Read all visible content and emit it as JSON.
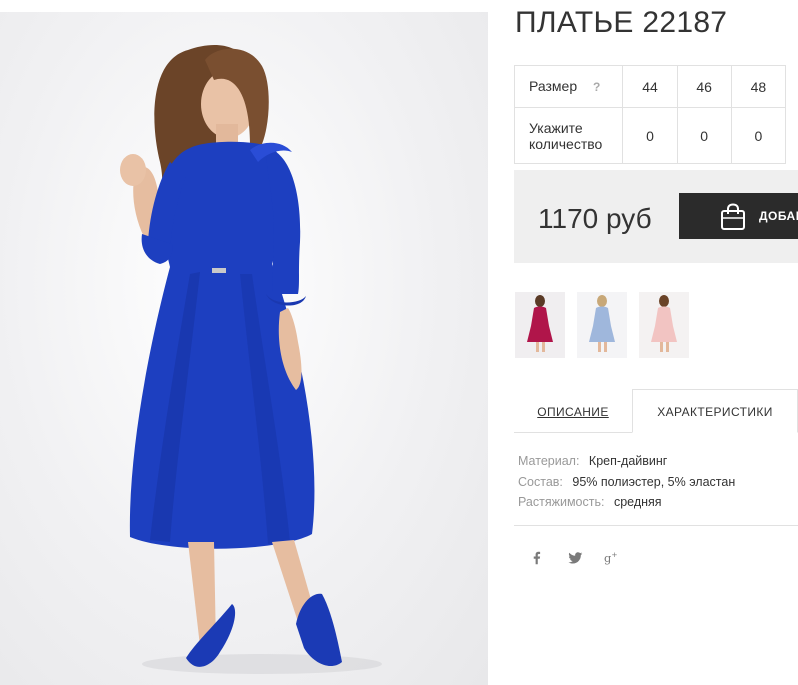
{
  "product": {
    "title": "ПЛАТЬЕ 22187",
    "image_alt": "Model wearing royal blue midi dress with ruffle sleeves and blue pumps"
  },
  "size_table": {
    "size_label": "Размер",
    "help_label": "?",
    "sizes": [
      "44",
      "46",
      "48"
    ],
    "quantity_label_line1": "Укажите",
    "quantity_label_line2": "количество",
    "quantities": [
      "0",
      "0",
      "0"
    ]
  },
  "purchase": {
    "price": "1170 руб",
    "cart_button_label": "ДОБАВИТЬ В КОРЗИНУ"
  },
  "thumbnails": [
    {
      "name": "thumb-magenta-dress",
      "color": "#b0154a"
    },
    {
      "name": "thumb-light-blue-dress",
      "color": "#9fb7dc"
    },
    {
      "name": "thumb-pink-dress",
      "color": "#f2c4c2"
    }
  ],
  "tabs": {
    "description": "ОПИСАНИЕ",
    "characteristics": "ХАРАКТЕРИСТИКИ",
    "active": "characteristics"
  },
  "characteristics": [
    {
      "key": "Материал:",
      "value": "Креп-дайвинг"
    },
    {
      "key": "Состав:",
      "value": "95% полиэстер, 5% эластан"
    },
    {
      "key": "Растяжимость:",
      "value": "средняя"
    }
  ],
  "social": [
    "facebook-icon",
    "twitter-icon",
    "google-plus-icon"
  ],
  "colors": {
    "dress_blue": "#1d3fc0",
    "button_dark": "#2b2b2b",
    "price_bg": "#efefef",
    "border": "#e1e1e1"
  }
}
